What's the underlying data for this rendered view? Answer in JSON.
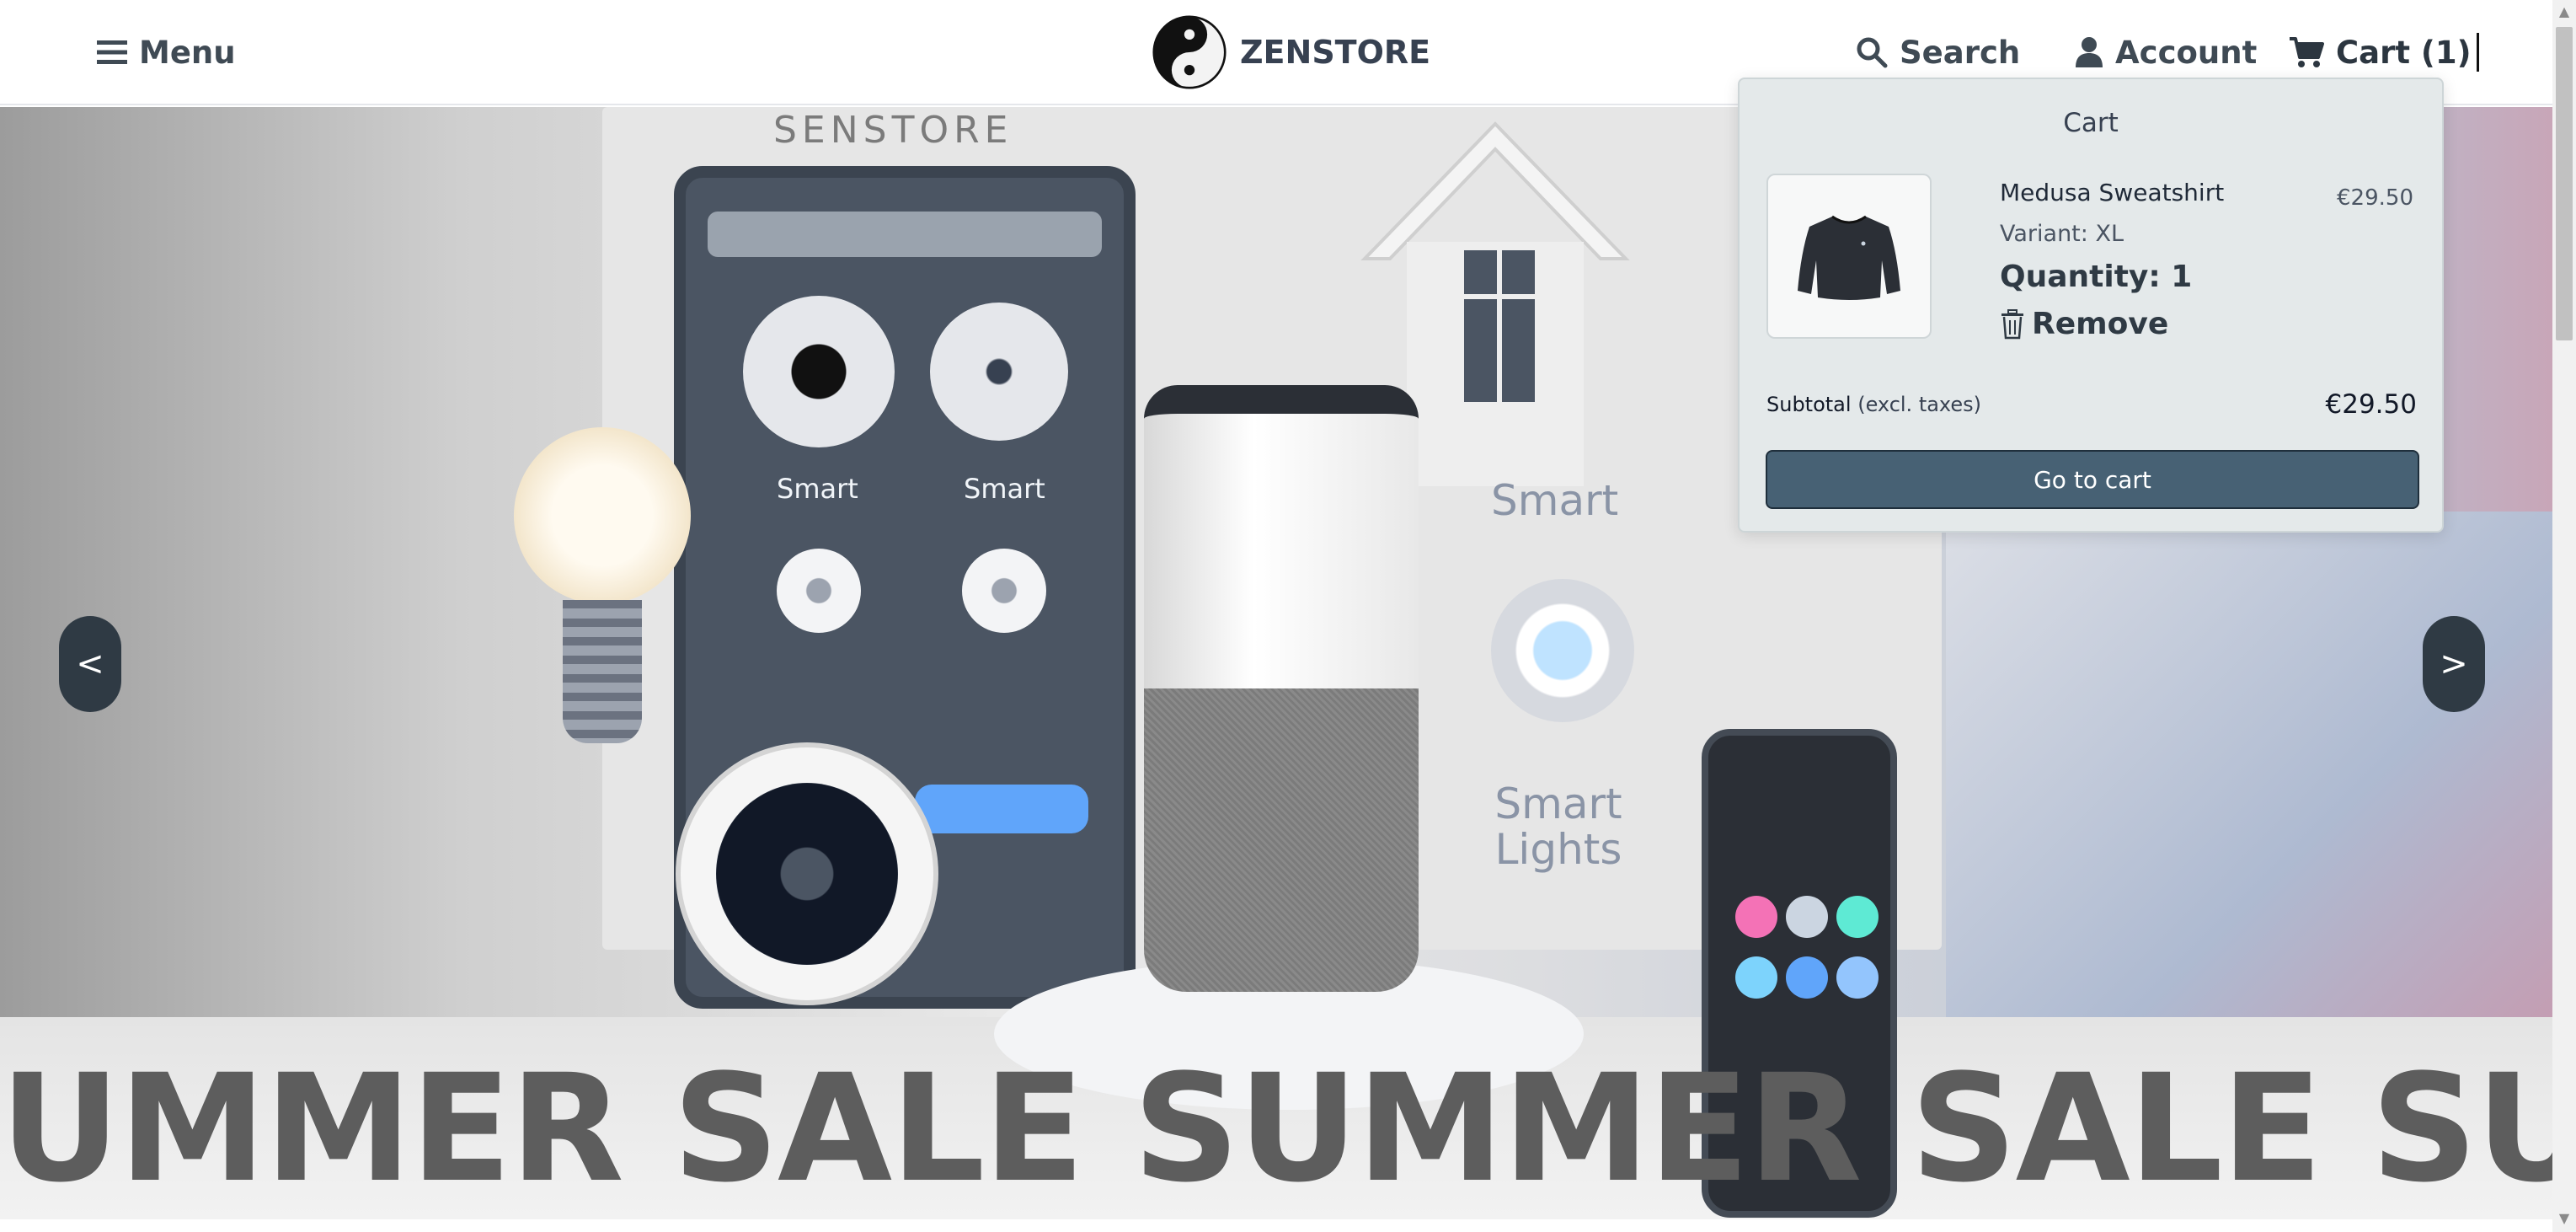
{
  "header": {
    "menu_label": "Menu",
    "brand_name": "ZENSTORE",
    "search_label": "Search",
    "account_label": "Account",
    "cart_label": "Cart (1)"
  },
  "hero": {
    "watermark": "SENSTORE",
    "headline": "UMMER SALE SUMMER SALE SUMME",
    "smart_label": "Smart",
    "smart_lights_label": "Smart Lights",
    "prev_label": "<",
    "next_label": ">",
    "accent_color": "#60a5fa"
  },
  "cart_dropdown": {
    "title": "Cart",
    "item": {
      "name": "Medusa Sweatshirt",
      "price": "€29.50",
      "variant": "Variant: XL",
      "quantity": "Quantity: 1",
      "remove_label": "Remove",
      "thumbnail_icon": "sweatshirt-icon"
    },
    "subtotal_label": "Subtotal",
    "subtotal_note": "(excl. taxes)",
    "subtotal_value": "€29.50",
    "go_to_cart_label": "Go to cart",
    "button_color": "#476174"
  }
}
